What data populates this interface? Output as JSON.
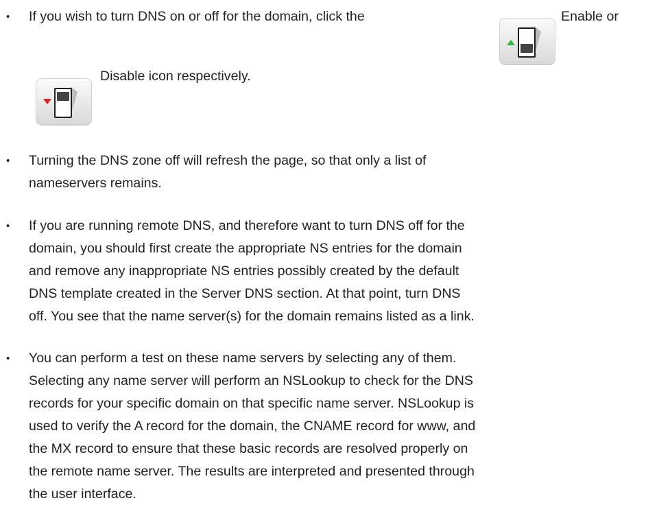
{
  "bullet_glyph": "•",
  "items": [
    {
      "text_before": "If you wish to turn DNS on or off for the domain, click the",
      "enable_after": "Enable or",
      "disable_after": "Disable icon respectively."
    },
    {
      "lines": [
        "Turning the DNS zone off will refresh the page, so that only a list of",
        "nameservers remains."
      ]
    },
    {
      "lines": [
        "If you are running remote DNS, and therefore want to turn DNS off for the",
        "domain, you should first create the appropriate NS entries for the domain",
        "and remove any inappropriate NS entries possibly created by the default",
        "DNS template created in the Server DNS section. At that point, turn DNS",
        "off. You see that the name server(s) for the domain remains listed as a link."
      ]
    },
    {
      "lines": [
        "You can perform a test on these name servers by selecting any of them.",
        "Selecting any name server will perform an NSLookup to check for the DNS",
        "records for your specific domain on that specific name server. NSLookup is",
        "used to verify the A record for the domain, the CNAME record for www, and",
        "the MX record to ensure that these basic records are resolved properly on",
        "the remote name server. The results are interpreted and presented through",
        "the user interface."
      ]
    }
  ],
  "icons": {
    "enable": "enable-switch-icon",
    "disable": "disable-switch-icon"
  },
  "colors": {
    "enable_arrow": "#2dbb46",
    "disable_arrow": "#d22a2a"
  }
}
